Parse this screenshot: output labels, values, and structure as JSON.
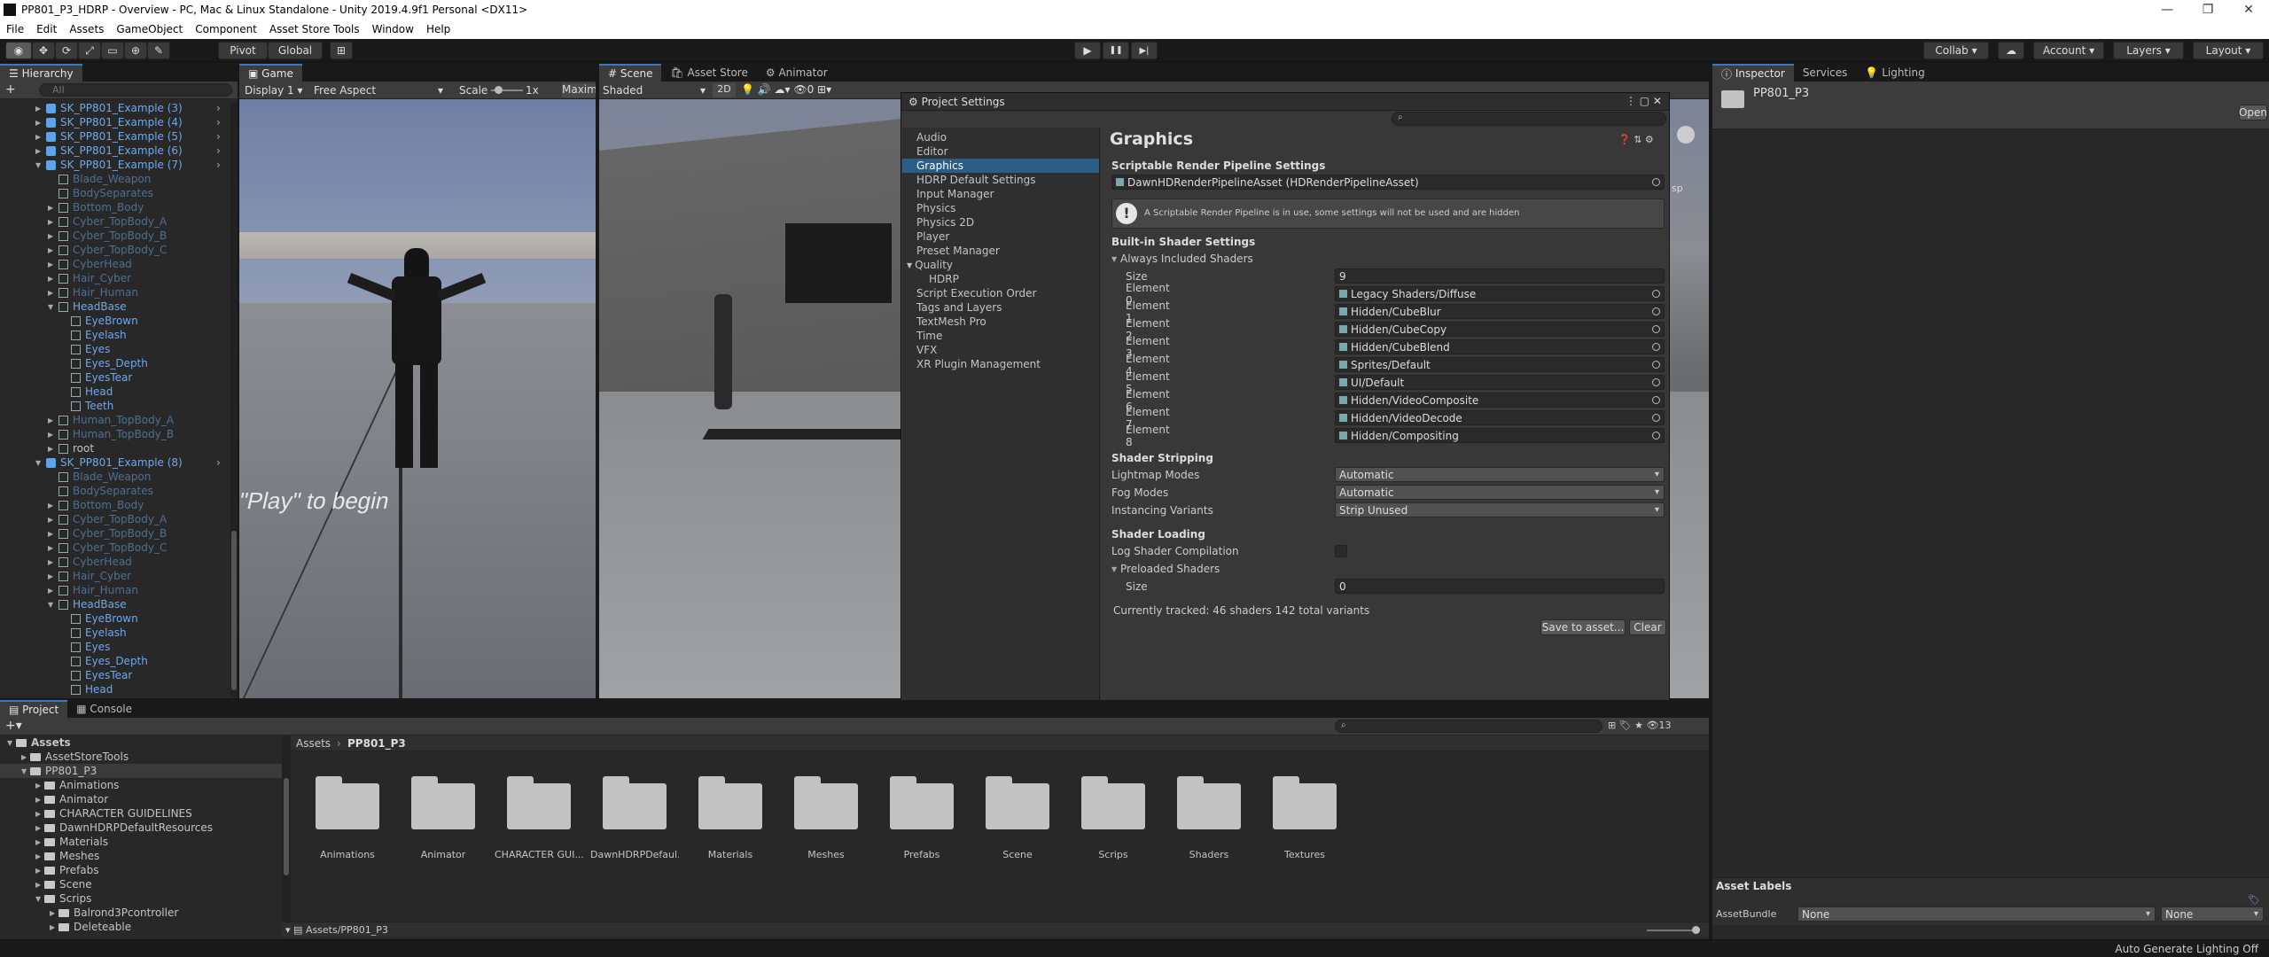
{
  "window": {
    "title": "PP801_P3_HDRP - Overview - PC, Mac & Linux Standalone - Unity 2019.4.9f1 Personal <DX11>",
    "controls": [
      "—",
      "❐",
      "✕"
    ]
  },
  "menu": [
    "File",
    "Edit",
    "Assets",
    "GameObject",
    "Component",
    "Asset Store Tools",
    "Window",
    "Help"
  ],
  "toolbar": {
    "pivot": "Pivot",
    "global": "Global",
    "play": "▶",
    "pause": "❚❚",
    "step": "▶|",
    "collab": "Collab",
    "account": "Account",
    "layers": "Layers",
    "layout": "Layout"
  },
  "hierarchy": {
    "tab": "Hierarchy",
    "search_placeholder": "All",
    "add": "+",
    "rows": [
      {
        "t": "SK_PP801_Example (3)",
        "d": 0,
        "k": "p",
        "e": "c"
      },
      {
        "t": "SK_PP801_Example (4)",
        "d": 0,
        "k": "p",
        "e": "c"
      },
      {
        "t": "SK_PP801_Example (5)",
        "d": 0,
        "k": "p",
        "e": "c"
      },
      {
        "t": "SK_PP801_Example (6)",
        "d": 0,
        "k": "p",
        "e": "c"
      },
      {
        "t": "SK_PP801_Example (7)",
        "d": 0,
        "k": "p",
        "e": "o"
      },
      {
        "t": "Blade_Weapon",
        "d": 1,
        "k": "dim",
        "e": ""
      },
      {
        "t": "BodySeparates",
        "d": 1,
        "k": "dim",
        "e": ""
      },
      {
        "t": "Bottom_Body",
        "d": 1,
        "k": "dim",
        "e": "c"
      },
      {
        "t": "Cyber_TopBody_A",
        "d": 1,
        "k": "dim",
        "e": "c"
      },
      {
        "t": "Cyber_TopBody_B",
        "d": 1,
        "k": "dim",
        "e": "c"
      },
      {
        "t": "Cyber_TopBody_C",
        "d": 1,
        "k": "dim",
        "e": "c"
      },
      {
        "t": "CyberHead",
        "d": 1,
        "k": "dim",
        "e": "c"
      },
      {
        "t": "Hair_Cyber",
        "d": 1,
        "k": "dim",
        "e": "c"
      },
      {
        "t": "Hair_Human",
        "d": 1,
        "k": "dim",
        "e": "c"
      },
      {
        "t": "HeadBase",
        "d": 1,
        "k": "b",
        "e": "o"
      },
      {
        "t": "EyeBrown",
        "d": 2,
        "k": "b",
        "e": ""
      },
      {
        "t": "Eyelash",
        "d": 2,
        "k": "b",
        "e": ""
      },
      {
        "t": "Eyes",
        "d": 2,
        "k": "b",
        "e": ""
      },
      {
        "t": "Eyes_Depth",
        "d": 2,
        "k": "b",
        "e": ""
      },
      {
        "t": "EyesTear",
        "d": 2,
        "k": "b",
        "e": ""
      },
      {
        "t": "Head",
        "d": 2,
        "k": "b",
        "e": ""
      },
      {
        "t": "Teeth",
        "d": 2,
        "k": "b",
        "e": ""
      },
      {
        "t": "Human_TopBody_A",
        "d": 1,
        "k": "dim",
        "e": "c"
      },
      {
        "t": "Human_TopBody_B",
        "d": 1,
        "k": "dim",
        "e": "c"
      },
      {
        "t": "root",
        "d": 1,
        "k": "n",
        "e": "c"
      },
      {
        "t": "SK_PP801_Example (8)",
        "d": 0,
        "k": "p",
        "e": "o"
      },
      {
        "t": "Blade_Weapon",
        "d": 1,
        "k": "dim",
        "e": ""
      },
      {
        "t": "BodySeparates",
        "d": 1,
        "k": "dim",
        "e": ""
      },
      {
        "t": "Bottom_Body",
        "d": 1,
        "k": "dim",
        "e": "c"
      },
      {
        "t": "Cyber_TopBody_A",
        "d": 1,
        "k": "dim",
        "e": "c"
      },
      {
        "t": "Cyber_TopBody_B",
        "d": 1,
        "k": "dim",
        "e": "c"
      },
      {
        "t": "Cyber_TopBody_C",
        "d": 1,
        "k": "dim",
        "e": "c"
      },
      {
        "t": "CyberHead",
        "d": 1,
        "k": "dim",
        "e": "c"
      },
      {
        "t": "Hair_Cyber",
        "d": 1,
        "k": "dim",
        "e": "c"
      },
      {
        "t": "Hair_Human",
        "d": 1,
        "k": "dim",
        "e": "c"
      },
      {
        "t": "HeadBase",
        "d": 1,
        "k": "b",
        "e": "o"
      },
      {
        "t": "EyeBrown",
        "d": 2,
        "k": "b",
        "e": ""
      },
      {
        "t": "Eyelash",
        "d": 2,
        "k": "b",
        "e": ""
      },
      {
        "t": "Eyes",
        "d": 2,
        "k": "b",
        "e": ""
      },
      {
        "t": "Eyes_Depth",
        "d": 2,
        "k": "b",
        "e": ""
      },
      {
        "t": "EyesTear",
        "d": 2,
        "k": "b",
        "e": ""
      },
      {
        "t": "Head",
        "d": 2,
        "k": "b",
        "e": ""
      }
    ]
  },
  "game": {
    "tab": "Game",
    "display": "Display 1",
    "aspect": "Free Aspect",
    "scale_label": "Scale",
    "scale_value": "1x",
    "maximize": "Maxim",
    "overlay": "\"Play\" to begin"
  },
  "scene": {
    "tab": "Scene",
    "asset_store_tab": "Asset Store",
    "animator_tab": "Animator",
    "shading": "Shaded",
    "mode2d": "2D",
    "persp": "sp"
  },
  "project_settings": {
    "title": "Project Settings",
    "categories": [
      {
        "t": "Audio",
        "d": 0
      },
      {
        "t": "Editor",
        "d": 0
      },
      {
        "t": "Graphics",
        "d": 0,
        "sel": true
      },
      {
        "t": "HDRP Default Settings",
        "d": 0
      },
      {
        "t": "Input Manager",
        "d": 0
      },
      {
        "t": "Physics",
        "d": 0
      },
      {
        "t": "Physics 2D",
        "d": 0
      },
      {
        "t": "Player",
        "d": 0
      },
      {
        "t": "Preset Manager",
        "d": 0
      },
      {
        "t": "Quality",
        "d": 0,
        "open": true
      },
      {
        "t": "HDRP",
        "d": 1
      },
      {
        "t": "Script Execution Order",
        "d": 0
      },
      {
        "t": "Tags and Layers",
        "d": 0
      },
      {
        "t": "TextMesh Pro",
        "d": 0
      },
      {
        "t": "Time",
        "d": 0
      },
      {
        "t": "VFX",
        "d": 0
      },
      {
        "t": "XR Plugin Management",
        "d": 0
      }
    ],
    "heading": "Graphics",
    "srp_header": "Scriptable Render Pipeline Settings",
    "srp_value": "DawnHDRenderPipelineAsset (HDRenderPipelineAsset)",
    "warning": "A Scriptable Render Pipeline is in use, some settings will not be used and are hidden",
    "builtin_header": "Built-in Shader Settings",
    "always_included": "Always Included Shaders",
    "size_label": "Size",
    "size_value": "9",
    "elements": [
      {
        "label": "Element 0",
        "value": "Legacy Shaders/Diffuse"
      },
      {
        "label": "Element 1",
        "value": "Hidden/CubeBlur"
      },
      {
        "label": "Element 2",
        "value": "Hidden/CubeCopy"
      },
      {
        "label": "Element 3",
        "value": "Hidden/CubeBlend"
      },
      {
        "label": "Element 4",
        "value": "Sprites/Default"
      },
      {
        "label": "Element 5",
        "value": "UI/Default"
      },
      {
        "label": "Element 6",
        "value": "Hidden/VideoComposite"
      },
      {
        "label": "Element 7",
        "value": "Hidden/VideoDecode"
      },
      {
        "label": "Element 8",
        "value": "Hidden/Compositing"
      }
    ],
    "stripping_header": "Shader Stripping",
    "lightmap_label": "Lightmap Modes",
    "lightmap_value": "Automatic",
    "fog_label": "Fog Modes",
    "fog_value": "Automatic",
    "instancing_label": "Instancing Variants",
    "instancing_value": "Strip Unused",
    "loading_header": "Shader Loading",
    "log_label": "Log Shader Compilation",
    "preloaded_label": "Preloaded Shaders",
    "preloaded_size_label": "Size",
    "preloaded_size_value": "0",
    "tracked": "Currently tracked: 46 shaders 142 total variants",
    "save_btn": "Save to asset...",
    "clear_btn": "Clear"
  },
  "inspector": {
    "tab": "Inspector",
    "services_tab": "Services",
    "lighting_tab": "Lighting",
    "asset_name": "PP801_P3",
    "open_btn": "Open",
    "labels_header": "Asset Labels",
    "bundle_label": "AssetBundle",
    "bundle_value": "None",
    "variant_value": "None"
  },
  "project": {
    "tab": "Project",
    "console_tab": "Console",
    "count": "13",
    "tree": [
      {
        "t": "Assets",
        "d": 0,
        "open": true,
        "bold": true
      },
      {
        "t": "AssetStoreTools",
        "d": 1
      },
      {
        "t": "PP801_P3",
        "d": 1,
        "open": true,
        "sel": true
      },
      {
        "t": "Animations",
        "d": 2
      },
      {
        "t": "Animator",
        "d": 2
      },
      {
        "t": "CHARACTER GUIDELINES",
        "d": 2
      },
      {
        "t": "DawnHDRPDefaultResources",
        "d": 2
      },
      {
        "t": "Materials",
        "d": 2
      },
      {
        "t": "Meshes",
        "d": 2
      },
      {
        "t": "Prefabs",
        "d": 2
      },
      {
        "t": "Scene",
        "d": 2
      },
      {
        "t": "Scrips",
        "d": 2,
        "open": true
      },
      {
        "t": "Balrond3Pcontroller",
        "d": 3
      },
      {
        "t": "Deleteable",
        "d": 3
      }
    ],
    "breadcrumb": [
      "Assets",
      "PP801_P3"
    ],
    "folders": [
      "Animations",
      "Animator",
      "CHARACTER GUI...",
      "DawnHDRPDefaul...",
      "Materials",
      "Meshes",
      "Prefabs",
      "Scene",
      "Scrips",
      "Shaders",
      "Textures"
    ],
    "path": "Assets/PP801_P3"
  },
  "status": {
    "right": "Auto Generate Lighting Off"
  },
  "colors": {
    "accent": "#3a79bb",
    "prefab": "#6ea8ec",
    "selected": "#2c5d87"
  }
}
